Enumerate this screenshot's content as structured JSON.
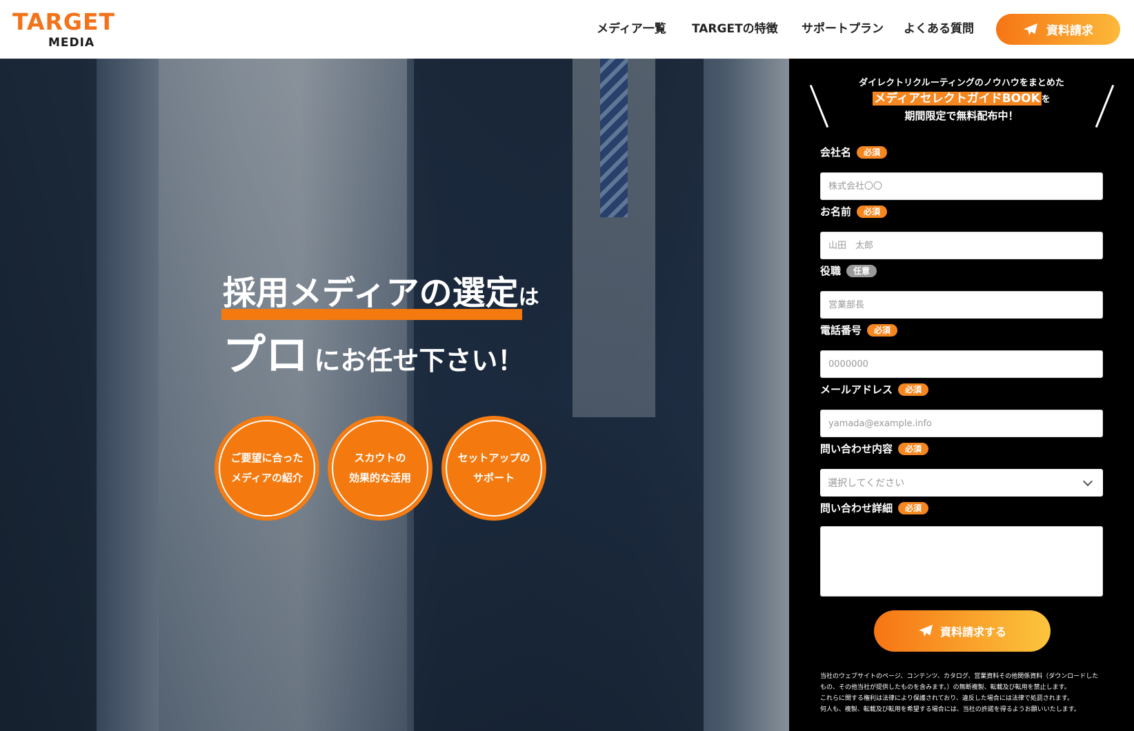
{
  "logo": {
    "top": "TARGET",
    "bottom": "MEDIA"
  },
  "nav": {
    "items": [
      "メディア一覧",
      "TARGETの特徴",
      "サポートプラン",
      "よくある質問"
    ],
    "cta_label": "資料請求"
  },
  "hero": {
    "line1_big": "採用メディアの選定",
    "line1_small": "は",
    "line2_big": "プロ",
    "line2_small": "にお任せ下さい！",
    "circles": [
      {
        "line1": "ご要望に合った",
        "line2": "メディアの紹介"
      },
      {
        "line1": "スカウトの",
        "line2": "効果的な活用"
      },
      {
        "line1": "セットアップの",
        "line2": "サポート"
      }
    ]
  },
  "form": {
    "intro_line1": "ダイレクトリクルーティングのノウハウをまとめた",
    "intro_highlight": "メディアセレクトガイドBOOK",
    "intro_particle": "を",
    "intro_line3": "期間限定で無料配布中！",
    "required_badge": "必須",
    "optional_badge": "任意",
    "fields": {
      "company": {
        "label": "会社名",
        "placeholder": "株式会社〇〇"
      },
      "name": {
        "label": "お名前",
        "placeholder": "山田　太郎"
      },
      "position": {
        "label": "役職",
        "placeholder": "営業部長"
      },
      "phone": {
        "label": "電話番号",
        "placeholder": "0000000"
      },
      "email": {
        "label": "メールアドレス",
        "placeholder": "yamada@example.info"
      },
      "inquiry_type": {
        "label": "問い合わせ内容",
        "selected": "選択してください"
      },
      "inquiry_detail": {
        "label": "問い合わせ詳細"
      }
    },
    "submit_label": "資料請求する",
    "notice": [
      "当社のウェブサイトのページ、コンテンツ、カタログ、営業資料その他関係資料（ダウンロードした",
      "もの、その他当社が提供したものを含みます。）の無断複製、転載及び転用を禁止します。",
      "これらに関する権利は法律により保護されており、違反した場合には法律で処罰されます。",
      "何人も、複製、転載及び転用を希望する場合には、当社の許諾を得るようお願いいたします。"
    ]
  },
  "colors": {
    "accent": "#f47a0f",
    "accent_light": "#fcc53d",
    "panel_bg": "#000000"
  }
}
